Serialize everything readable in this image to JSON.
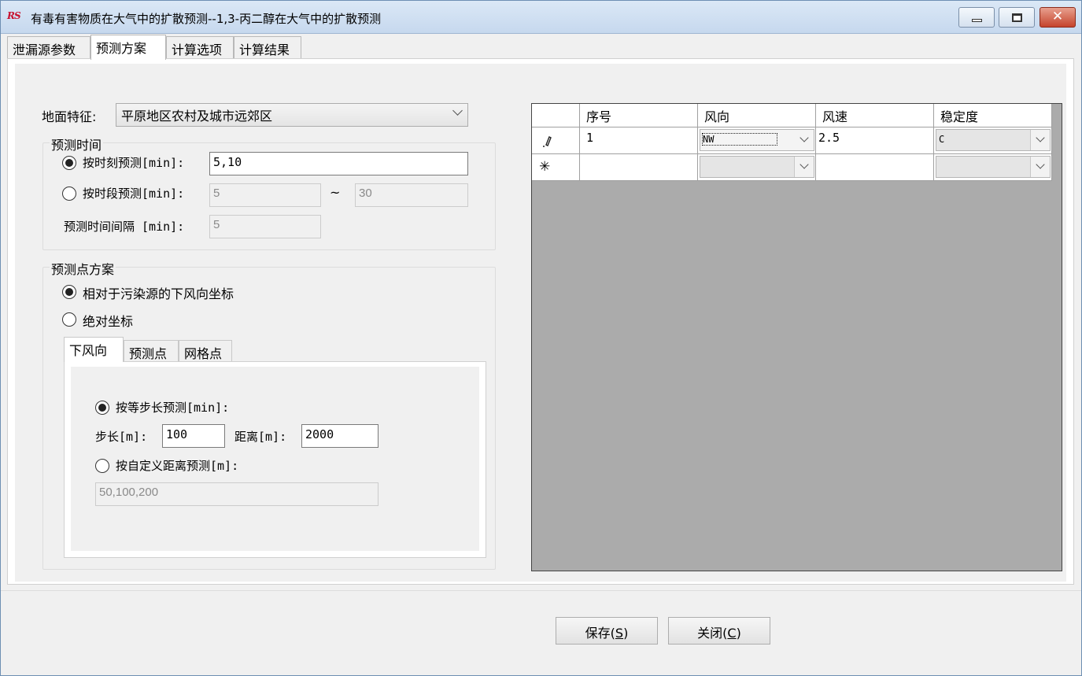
{
  "window": {
    "title": "有毒有害物质在大气中的扩散预测--1,3-丙二醇在大气中的扩散预测",
    "icon": "rs-logo-icon",
    "controls": {
      "minimize": "minimize-icon",
      "maximize": "maximize-icon",
      "close": "✕"
    }
  },
  "tabs": [
    {
      "label": "泄漏源参数",
      "active": false
    },
    {
      "label": "预测方案",
      "active": true
    },
    {
      "label": "计算选项",
      "active": false
    },
    {
      "label": "计算结果",
      "active": false
    }
  ],
  "ground": {
    "label": "地面特征:",
    "value": "平原地区农村及城市远郊区"
  },
  "predict_time": {
    "legend": "预测时间",
    "by_moment": {
      "label": "按时刻预测[min]:",
      "checked": true,
      "value": "5,10"
    },
    "by_period": {
      "label": "按时段预测[min]:",
      "checked": false,
      "from": "5",
      "tilde": "~",
      "to": "30"
    },
    "interval": {
      "label": "预测时间间隔 [min]:",
      "value": "5"
    }
  },
  "predict_points": {
    "legend": "预测点方案",
    "relative": {
      "label": "相对于污染源的下风向坐标",
      "checked": true
    },
    "absolute": {
      "label": "绝对坐标",
      "checked": false
    },
    "subtabs": [
      {
        "label": "下风向",
        "active": true
      },
      {
        "label": "预测点",
        "active": false
      },
      {
        "label": "网格点",
        "active": false
      }
    ],
    "equal_step": {
      "label": "按等步长预测[min]:",
      "checked": true
    },
    "step": {
      "label": "步长[m]:",
      "value": "100"
    },
    "distance": {
      "label": "距离[m]:",
      "value": "2000"
    },
    "custom": {
      "label": "按自定义距离预测[m]:",
      "checked": false,
      "value": "50,100,200"
    }
  },
  "grid": {
    "headers": [
      "序号",
      "风向",
      "风速",
      "稳定度"
    ],
    "rows": [
      {
        "indicator": "pencil-icon",
        "num": "1",
        "wind_dir": "NW",
        "wind_speed": "2.5",
        "stability": "C"
      },
      {
        "indicator": "asterisk-icon",
        "num": "",
        "wind_dir": "",
        "wind_speed": "",
        "stability": ""
      }
    ],
    "new_row_marker": "✳"
  },
  "buttons": {
    "save": {
      "label": "保存(",
      "key": "S",
      "end": ")"
    },
    "close": {
      "label": "关闭(",
      "key": "C",
      "end": ")"
    }
  }
}
